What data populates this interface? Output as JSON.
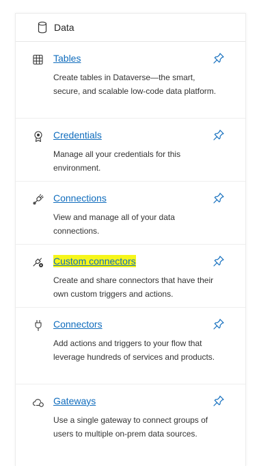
{
  "panel": {
    "header": {
      "title": "Data",
      "icon": "database-icon"
    },
    "items": [
      {
        "title": "Tables",
        "description": "Create tables in Dataverse—the smart, secure, and scalable low-code data platform.",
        "icon": "table-icon",
        "highlighted": false
      },
      {
        "title": "Credentials",
        "description": "Manage all your credentials for this environment.",
        "icon": "credential-badge-icon",
        "highlighted": false
      },
      {
        "title": "Connections",
        "description": "View and manage all of your data connections.",
        "icon": "plug-connect-icon",
        "highlighted": false
      },
      {
        "title": "Custom connectors",
        "description": "Create and share connectors that have their own custom triggers and actions.",
        "icon": "plug-settings-icon",
        "highlighted": true
      },
      {
        "title": "Connectors",
        "description": "Add actions and triggers to your flow that leverage hundreds of services and products.",
        "icon": "plug-icon",
        "highlighted": false
      },
      {
        "title": "Gateways",
        "description": "Use a single gateway to connect groups of users to multiple on-prem data sources.",
        "icon": "cloud-gateway-icon",
        "highlighted": false
      }
    ],
    "pin_icon": "pin-icon"
  },
  "colors": {
    "link": "#0f6cbd",
    "highlight": "#f6f61b",
    "text": "#242424"
  }
}
